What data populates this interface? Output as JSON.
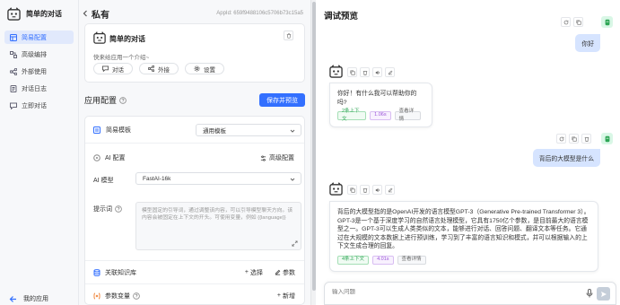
{
  "nav": {
    "title": "简单的对话",
    "items": [
      {
        "label": "简易配置",
        "active": true
      },
      {
        "label": "高级编排",
        "active": false
      },
      {
        "label": "外部使用",
        "active": false
      },
      {
        "label": "对话日志",
        "active": false
      },
      {
        "label": "立即对话",
        "active": false
      }
    ],
    "footer": "我的应用"
  },
  "header": {
    "title": "私有",
    "appid": "AppId: 659f9488106c5706b73c15a5"
  },
  "app": {
    "name": "简单的对话",
    "intro_placeholder": "快来给应用一个介绍~",
    "chips": {
      "chat": "对话",
      "external": "外接",
      "settings": "设置"
    }
  },
  "config": {
    "title": "应用配置",
    "save_button": "保存并预览",
    "mode_label": "简易模板",
    "mode_value": "通用模板",
    "ai_title": "AI 配置",
    "advanced": "高级配置",
    "model_label": "AI 模型",
    "model_value": "FastAI-16k",
    "prompt_label": "提示词",
    "prompt_placeholder": "模型固定的引导词，通过调整该内容，可以引导模型聊天方向。该内容会被固定在上下文的开头。可使用变量，例如 {{language}}",
    "kb_title": "关联知识库",
    "kb_select": "选择",
    "kb_params": "参数",
    "var_title": "参数变量",
    "var_add": "新增"
  },
  "chat": {
    "title": "调试预览",
    "messages": [
      {
        "role": "user",
        "text": "你好"
      },
      {
        "role": "bot",
        "text": "你好！有什么我可以帮助你的吗?",
        "tags": [
          "2条上下文",
          "1.06s",
          "查看详情"
        ]
      },
      {
        "role": "user",
        "text": "背后的大模型是什么"
      },
      {
        "role": "bot",
        "text": "背后的大模型指的是OpenAI开发的语言模型GPT-3（Generative Pre-trained Transformer 3）。GPT-3是一个基于深度学习的自然语言处理模型，它具有1750亿个参数，是目前最大的语言模型之一。GPT-3可以生成人类类似的文本，能够进行对话、回答问题、翻译文本等任务。它通过在大规模的文本数据上进行预训练，学习到了丰富的语言知识和模式，并可以根据输入的上下文生成合理的回复。",
        "tags": [
          "4条上下文",
          "4.01s",
          "查看详情"
        ]
      }
    ],
    "input_placeholder": "输入问题"
  },
  "colors": {
    "accent": "#3370ff",
    "user_bubble": "#d6e4ff",
    "send_disabled": "#c5ced9"
  }
}
